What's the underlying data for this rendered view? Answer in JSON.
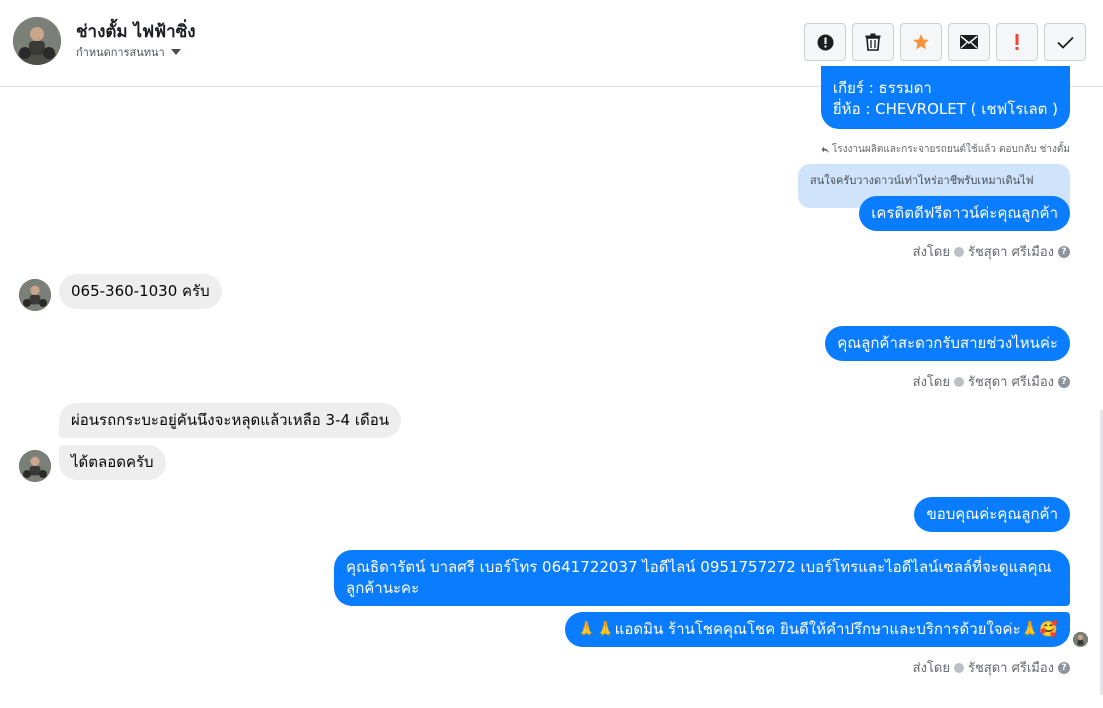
{
  "header": {
    "contact_name": "ช่างตั้ม ไฟฟ้าซิ่ง",
    "sub_label": "กำหนดการสนทนา",
    "toolbar": [
      {
        "name": "mark-spam-button",
        "icon": "alert-circle-icon"
      },
      {
        "name": "delete-button",
        "icon": "trash-icon"
      },
      {
        "name": "star-button",
        "icon": "star-icon",
        "color": "#f7923b"
      },
      {
        "name": "mark-unread-button",
        "icon": "mail-icon"
      },
      {
        "name": "follow-up-button",
        "icon": "exclamation-icon",
        "color": "#fa3e3e"
      },
      {
        "name": "mark-done-button",
        "icon": "check-icon"
      }
    ]
  },
  "colors": {
    "outgoing_bubble": "#0a7cff",
    "incoming_bubble": "#eeeeee",
    "quoted_bubble": "#cfe3fb"
  },
  "messages": {
    "m1_line1": "เกียร์ : ธรรมดา",
    "m1_line2": "ยี่ห้อ : CHEVROLET ( เชฟโรเลต )",
    "reply_note": "โรงงานผลิตและกระจายรถยนต์ใช้แล้ว ตอบกลับ ช่างตั้ม",
    "quoted_text": "สนใจครับวางดาวน์เท่าไหร่อาชีพรับเหมาเดินไฟ",
    "m2": "เครดิตดีฟรีดาวน์ค่ะคุณลูกค้า",
    "m3": "065-360-1030 ครับ",
    "m4": "คุณลูกค้าสะดวกรับสายช่วงไหนค่ะ",
    "m5": "ผ่อนรถกระบะอยู่คันนึงจะหลุดแล้วเหลือ 3-4 เดือน",
    "m6": "ได้ตลอดครับ",
    "m7": "ขอบคุณค่ะคุณลูกค้า",
    "m8_line1": "คุณธิดารัตน์ บาลศรี เบอร์โทร 0641722037  ไอดีไลน์ 0951757272   เบอร์โทรและไอดีไลน์เซลล์ที่จะดูแลคุณ",
    "m8_line2": "ลูกค้านะคะ",
    "m9": "🙏🙏แอดมิน ร้านโชคคุณโชค ยินดีให้คำปรึกษาและบริการด้วยใจค่ะ🙏🥰"
  },
  "sent_by": {
    "prefix": "ส่งโดย",
    "name": "รัชสุดา ศรีเมือง",
    "help": "?"
  }
}
